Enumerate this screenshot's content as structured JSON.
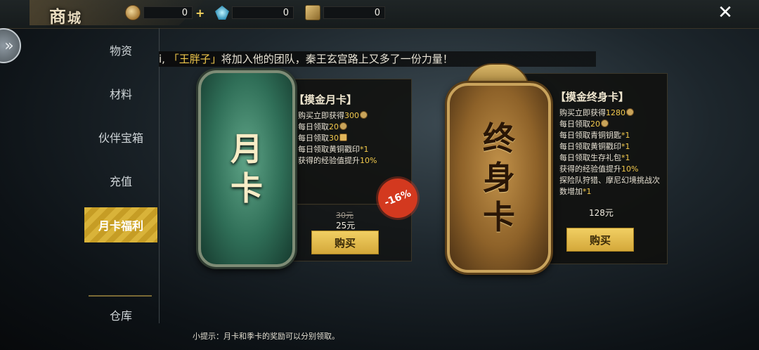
{
  "header": {
    "title_big": "商",
    "title_small": "城",
    "close_label": "✕",
    "currencies": [
      {
        "icon": "coin-icon",
        "value": "0",
        "plus": "+"
      },
      {
        "icon": "gem-icon",
        "value": "0"
      },
      {
        "icon": "scroll-icon",
        "value": "0"
      }
    ]
  },
  "sidebar": {
    "items": [
      {
        "label": "物资"
      },
      {
        "label": "材料"
      },
      {
        "label": "伙伴宝箱"
      },
      {
        "label": "充值"
      },
      {
        "label": "月卡福利"
      },
      {
        "label": "仓库"
      }
    ],
    "active_index": 4
  },
  "ticker": {
    "lead": "i, ",
    "highlight": "「王胖子」",
    "rest": "将加入他的团队，秦王玄宫路上又多了一份力量！"
  },
  "monthly_card": {
    "plaque_line1": "月",
    "plaque_line2": "卡",
    "title": "【摸金月卡】",
    "perks": [
      {
        "text": "购买立即获得",
        "value": "300"
      },
      {
        "text": "每日领取",
        "value": "20"
      },
      {
        "text": "每日领取",
        "value": "30"
      },
      {
        "text": "每日领取黄铜戳印",
        "value": "*1"
      },
      {
        "text": "获得的经验值提升",
        "value": "10%"
      }
    ],
    "discount": "-16%",
    "old_price": "30元",
    "price": "25元",
    "buy_label": "购买"
  },
  "lifetime_card": {
    "plaque_line1": "终",
    "plaque_line2": "身",
    "plaque_line3": "卡",
    "title": "【摸金终身卡】",
    "perks": [
      {
        "text": "购买立即获得",
        "value": "1280"
      },
      {
        "text": "每日领取",
        "value": "20"
      },
      {
        "text": "每日领取青铜钥匙",
        "value": "*1"
      },
      {
        "text": "每日领取黄铜戳印",
        "value": "*1"
      },
      {
        "text": "每日领取生存礼包",
        "value": "*1"
      },
      {
        "text": "获得的经验值提升",
        "value": "10%"
      },
      {
        "text": "探险队狩猎、摩尼幻境挑战次",
        "value": ""
      },
      {
        "text": "数增加",
        "value": "*1"
      }
    ],
    "price": "128元",
    "buy_label": "购买"
  },
  "hint": "小提示：月卡和季卡的奖励可以分别领取。",
  "colors": {
    "accent_gold": "#f2c94c",
    "button_gold": "#e6bf4f",
    "discount_red": "#d3391f"
  }
}
